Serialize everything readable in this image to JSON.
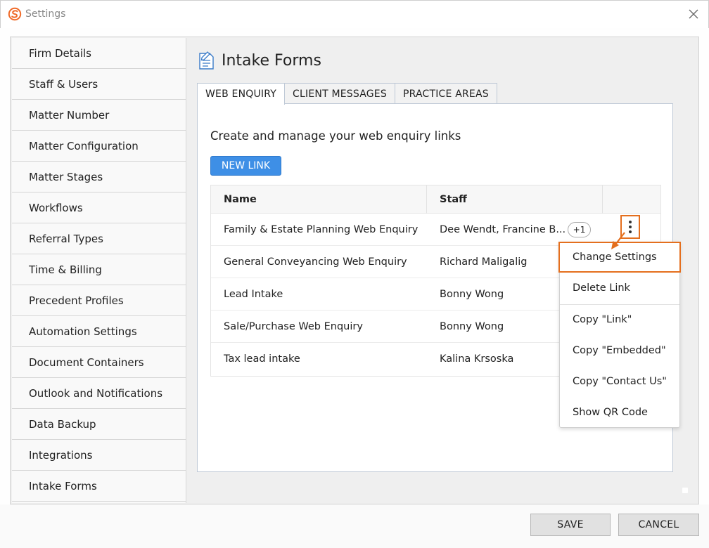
{
  "window": {
    "title": "Settings"
  },
  "sidebar": {
    "items": [
      {
        "label": "Firm Details"
      },
      {
        "label": "Staff & Users"
      },
      {
        "label": "Matter Number"
      },
      {
        "label": "Matter Configuration"
      },
      {
        "label": "Matter Stages"
      },
      {
        "label": "Workflows"
      },
      {
        "label": "Referral Types"
      },
      {
        "label": "Time & Billing"
      },
      {
        "label": "Precedent Profiles"
      },
      {
        "label": "Automation Settings"
      },
      {
        "label": "Document Containers"
      },
      {
        "label": "Outlook and Notifications"
      },
      {
        "label": "Data Backup"
      },
      {
        "label": "Integrations"
      },
      {
        "label": "Intake Forms"
      }
    ]
  },
  "page": {
    "title": "Intake Forms"
  },
  "tabs": [
    {
      "label": "WEB ENQUIRY"
    },
    {
      "label": "CLIENT MESSAGES"
    },
    {
      "label": "PRACTICE AREAS"
    }
  ],
  "panel": {
    "heading": "Create and manage your web enquiry links",
    "new_link_label": "NEW LINK"
  },
  "table": {
    "headers": {
      "name": "Name",
      "staff": "Staff"
    },
    "rows": [
      {
        "name": "Family & Estate Planning Web Enquiry",
        "staff": "Dee Wendt, Francine B...",
        "badge": "+1"
      },
      {
        "name": "General Conveyancing Web Enquiry",
        "staff": "Richard Maligalig"
      },
      {
        "name": "Lead Intake",
        "staff": "Bonny Wong"
      },
      {
        "name": "Sale/Purchase Web Enquiry",
        "staff": "Bonny Wong"
      },
      {
        "name": "Tax lead intake",
        "staff": "Kalina Krsoska"
      }
    ]
  },
  "context_menu": {
    "items": [
      {
        "label": "Change Settings"
      },
      {
        "label": "Delete Link"
      },
      {
        "label": "Copy \"Link\""
      },
      {
        "label": "Copy \"Embedded\""
      },
      {
        "label": "Copy \"Contact Us\""
      },
      {
        "label": "Show QR Code"
      }
    ]
  },
  "footer": {
    "save_label": "SAVE",
    "cancel_label": "CANCEL"
  },
  "colors": {
    "accent_orange": "#e46f1e",
    "primary_blue": "#3e8fe6",
    "logo_orange": "#f06a28"
  }
}
